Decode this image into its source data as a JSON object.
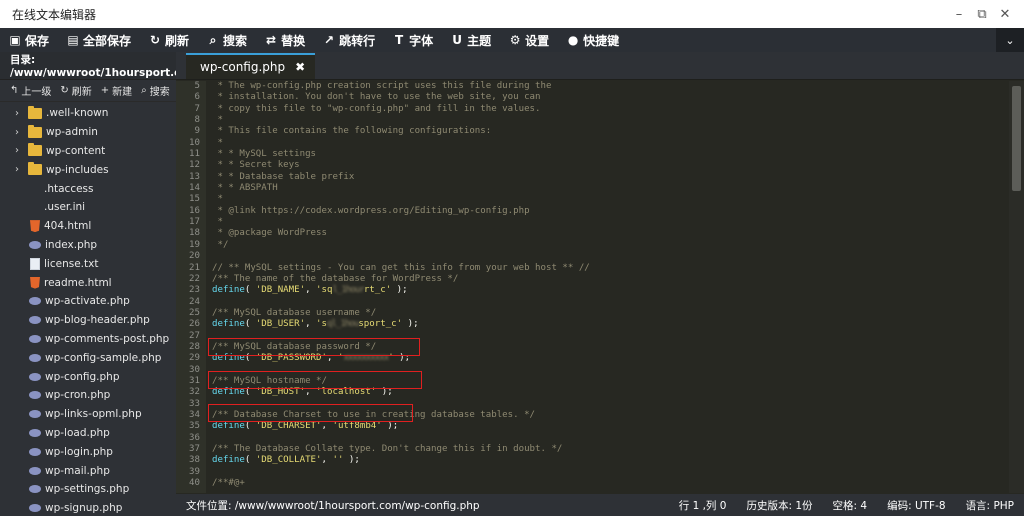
{
  "window": {
    "title": "在线文本编辑器",
    "controls": [
      "minimize-icon",
      "maximize-icon",
      "close-icon"
    ]
  },
  "toolbar": {
    "buttons": [
      {
        "icon": "save-icon",
        "glyph": "▣",
        "label": "保存"
      },
      {
        "icon": "save-all-icon",
        "glyph": "▤",
        "label": "全部保存"
      },
      {
        "icon": "refresh-icon",
        "glyph": "↻",
        "label": "刷新"
      },
      {
        "icon": "search-icon",
        "glyph": "⌕",
        "label": "搜索"
      },
      {
        "icon": "replace-icon",
        "glyph": "⇄",
        "label": "替换"
      },
      {
        "icon": "goto-line-icon",
        "glyph": "↗",
        "label": "跳转行"
      },
      {
        "icon": "font-icon",
        "glyph": "T",
        "label": "字体"
      },
      {
        "icon": "theme-icon",
        "glyph": "U",
        "label": "主题"
      },
      {
        "icon": "settings-icon",
        "glyph": "⚙",
        "label": "设置"
      },
      {
        "icon": "shortcut-icon",
        "glyph": "●",
        "label": "快捷键"
      }
    ],
    "collapse_glyph": "⌄"
  },
  "sidebar": {
    "directory": "目录: /www/wwwroot/1hoursport.com",
    "actions": [
      {
        "icon": "up-level-icon",
        "glyph": "↰",
        "label": "上一级"
      },
      {
        "icon": "refresh-icon",
        "glyph": "↻",
        "label": "刷新"
      },
      {
        "icon": "plus-icon",
        "glyph": "+",
        "label": "新建"
      },
      {
        "icon": "search-icon",
        "glyph": "⌕",
        "label": "搜索"
      }
    ],
    "files": [
      {
        "name": ".well-known",
        "type": "folder"
      },
      {
        "name": "wp-admin",
        "type": "folder"
      },
      {
        "name": "wp-content",
        "type": "folder"
      },
      {
        "name": "wp-includes",
        "type": "folder"
      },
      {
        "name": ".htaccess",
        "type": "none"
      },
      {
        "name": ".user.ini",
        "type": "none"
      },
      {
        "name": "404.html",
        "type": "html"
      },
      {
        "name": "index.php",
        "type": "php"
      },
      {
        "name": "license.txt",
        "type": "txt"
      },
      {
        "name": "readme.html",
        "type": "html"
      },
      {
        "name": "wp-activate.php",
        "type": "php"
      },
      {
        "name": "wp-blog-header.php",
        "type": "php"
      },
      {
        "name": "wp-comments-post.php",
        "type": "php"
      },
      {
        "name": "wp-config-sample.php",
        "type": "php"
      },
      {
        "name": "wp-config.php",
        "type": "php"
      },
      {
        "name": "wp-cron.php",
        "type": "php"
      },
      {
        "name": "wp-links-opml.php",
        "type": "php"
      },
      {
        "name": "wp-load.php",
        "type": "php"
      },
      {
        "name": "wp-login.php",
        "type": "php"
      },
      {
        "name": "wp-mail.php",
        "type": "php"
      },
      {
        "name": "wp-settings.php",
        "type": "php"
      },
      {
        "name": "wp-signup.php",
        "type": "php"
      }
    ]
  },
  "editor": {
    "tab_label": "wp-config.php",
    "tab_close": "✖",
    "collapse_label": "<",
    "lines": [
      {
        "n": "5",
        "segs": [
          {
            "t": " * The wp-config.php creation script uses this file during the",
            "c": "comment"
          }
        ]
      },
      {
        "n": "6",
        "segs": [
          {
            "t": " * installation. You don't have to use the web site, you can",
            "c": "comment"
          }
        ]
      },
      {
        "n": "7",
        "segs": [
          {
            "t": " * copy this file to \"wp-config.php\" and fill in the values.",
            "c": "comment"
          }
        ]
      },
      {
        "n": "8",
        "segs": [
          {
            "t": " *",
            "c": "comment"
          }
        ]
      },
      {
        "n": "9",
        "segs": [
          {
            "t": " * This file contains the following configurations:",
            "c": "comment"
          }
        ]
      },
      {
        "n": "10",
        "segs": [
          {
            "t": " *",
            "c": "comment"
          }
        ]
      },
      {
        "n": "11",
        "segs": [
          {
            "t": " * * MySQL settings",
            "c": "comment"
          }
        ]
      },
      {
        "n": "12",
        "segs": [
          {
            "t": " * * Secret keys",
            "c": "comment"
          }
        ]
      },
      {
        "n": "13",
        "segs": [
          {
            "t": " * * Database table prefix",
            "c": "comment"
          }
        ]
      },
      {
        "n": "14",
        "segs": [
          {
            "t": " * * ABSPATH",
            "c": "comment"
          }
        ]
      },
      {
        "n": "15",
        "segs": [
          {
            "t": " *",
            "c": "comment"
          }
        ]
      },
      {
        "n": "16",
        "segs": [
          {
            "t": " * @link https://codex.wordpress.org/Editing_wp-config.php",
            "c": "comment"
          }
        ]
      },
      {
        "n": "17",
        "segs": [
          {
            "t": " *",
            "c": "comment"
          }
        ]
      },
      {
        "n": "18",
        "segs": [
          {
            "t": " * @package WordPress",
            "c": "comment"
          }
        ]
      },
      {
        "n": "19",
        "segs": [
          {
            "t": " */",
            "c": "comment"
          }
        ]
      },
      {
        "n": "20",
        "segs": []
      },
      {
        "n": "21",
        "segs": [
          {
            "t": "// ** MySQL settings - You can get this info from your web host ** //",
            "c": "comment"
          }
        ]
      },
      {
        "n": "22",
        "segs": [
          {
            "t": "/** The name of the database for WordPress */",
            "c": "comment"
          }
        ]
      },
      {
        "n": "23",
        "segs": [
          {
            "t": "define",
            "c": "func"
          },
          {
            "t": "( ",
            "c": "punc"
          },
          {
            "t": "'DB_NAME'",
            "c": "str"
          },
          {
            "t": ", ",
            "c": "punc"
          },
          {
            "t": "'sq",
            "c": "str"
          },
          {
            "t": "l_1hour",
            "c": "blur"
          },
          {
            "t": "rt_c'",
            "c": "str"
          },
          {
            "t": " );",
            "c": "punc"
          }
        ]
      },
      {
        "n": "24",
        "segs": []
      },
      {
        "n": "25",
        "segs": [
          {
            "t": "/** MySQL database username */",
            "c": "comment"
          }
        ]
      },
      {
        "n": "26",
        "segs": [
          {
            "t": "define",
            "c": "func"
          },
          {
            "t": "( ",
            "c": "punc"
          },
          {
            "t": "'DB_USER'",
            "c": "str"
          },
          {
            "t": ", ",
            "c": "punc"
          },
          {
            "t": "'s",
            "c": "str"
          },
          {
            "t": "ql_1hou",
            "c": "blur"
          },
          {
            "t": "sport_c'",
            "c": "str"
          },
          {
            "t": " );",
            "c": "punc"
          }
        ]
      },
      {
        "n": "27",
        "segs": []
      },
      {
        "n": "28",
        "segs": [
          {
            "t": "/** MySQL database password */",
            "c": "comment"
          }
        ]
      },
      {
        "n": "29",
        "segs": [
          {
            "t": "define",
            "c": "func"
          },
          {
            "t": "( ",
            "c": "punc"
          },
          {
            "t": "'DB_PASSWORD'",
            "c": "str"
          },
          {
            "t": ", ",
            "c": "punc"
          },
          {
            "t": "'",
            "c": "str"
          },
          {
            "t": "xxxxxxxxxx",
            "c": "blur"
          },
          {
            "t": "'",
            "c": "str"
          },
          {
            "t": " );",
            "c": "punc"
          }
        ]
      },
      {
        "n": "30",
        "segs": []
      },
      {
        "n": "31",
        "segs": [
          {
            "t": "/** MySQL hostname */",
            "c": "comment"
          }
        ]
      },
      {
        "n": "32",
        "segs": [
          {
            "t": "define",
            "c": "func"
          },
          {
            "t": "( ",
            "c": "punc"
          },
          {
            "t": "'DB_HOST'",
            "c": "str"
          },
          {
            "t": ", ",
            "c": "punc"
          },
          {
            "t": "'localhost'",
            "c": "str"
          },
          {
            "t": " );",
            "c": "punc"
          }
        ]
      },
      {
        "n": "33",
        "segs": []
      },
      {
        "n": "34",
        "segs": [
          {
            "t": "/** Database Charset to use in creating database tables. */",
            "c": "comment"
          }
        ]
      },
      {
        "n": "35",
        "segs": [
          {
            "t": "define",
            "c": "func"
          },
          {
            "t": "( ",
            "c": "punc"
          },
          {
            "t": "'DB_CHARSET'",
            "c": "str"
          },
          {
            "t": ", ",
            "c": "punc"
          },
          {
            "t": "'utf8mb4'",
            "c": "str"
          },
          {
            "t": " );",
            "c": "punc"
          }
        ]
      },
      {
        "n": "36",
        "segs": []
      },
      {
        "n": "37",
        "segs": [
          {
            "t": "/** The Database Collate type. Don't change this if in doubt. */",
            "c": "comment"
          }
        ]
      },
      {
        "n": "38",
        "segs": [
          {
            "t": "define",
            "c": "func"
          },
          {
            "t": "( ",
            "c": "punc"
          },
          {
            "t": "'DB_COLLATE'",
            "c": "str"
          },
          {
            "t": ", ",
            "c": "punc"
          },
          {
            "t": "''",
            "c": "str"
          },
          {
            "t": " );",
            "c": "punc"
          }
        ]
      },
      {
        "n": "39",
        "segs": []
      },
      {
        "n": "40",
        "segs": [
          {
            "t": "/**#@+",
            "c": "comment"
          }
        ]
      }
    ]
  },
  "statusbar": {
    "path": "文件位置: /www/wwwroot/1hoursport.com/wp-config.php",
    "position": "行 1 ,列 0",
    "history": "历史版本: 1份",
    "indent": "空格: 4",
    "encoding": "编码: UTF-8",
    "language": "语言: PHP"
  }
}
